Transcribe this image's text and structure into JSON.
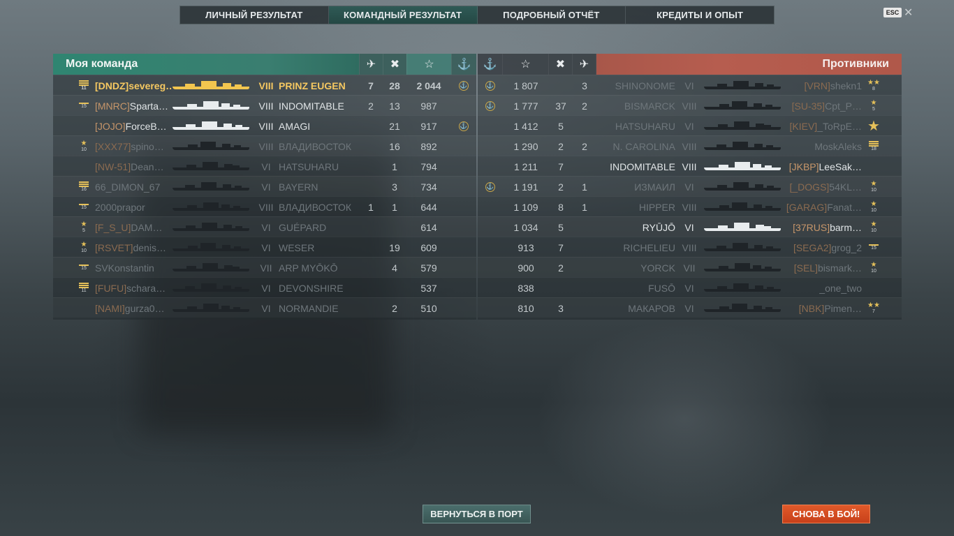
{
  "tabs": [
    {
      "label": "ЛИЧНЫЙ РЕЗУЛЬТАТ",
      "active": false
    },
    {
      "label": "КОМАНДНЫЙ РЕЗУЛЬТАТ",
      "active": true
    },
    {
      "label": "ПОДРОБНЫЙ ОТЧЁТ",
      "active": false
    },
    {
      "label": "КРЕДИТЫ И ОПЫТ",
      "active": false
    }
  ],
  "esc_label": "ESC",
  "my_team": {
    "title": "Моя команда",
    "header_icons": [
      "plane-kill-icon",
      "frag-icon",
      "star-icon",
      "anchor-icon"
    ],
    "rows": [
      {
        "rank": "11",
        "rank_style": "bars",
        "tag": "[DNDZ]",
        "player": "severeg…",
        "tier": "VIII",
        "ship": "PRINZ EUGEN",
        "c1": "7",
        "c2": "28",
        "xp": "2 044",
        "anchor": true,
        "style": "hl",
        "sil": "yellow"
      },
      {
        "rank": "15",
        "rank_style": "bar",
        "tag": "[MNRC]",
        "player": "Sparta…",
        "tier": "VIII",
        "ship": "INDOMITABLE",
        "c1": "2",
        "c2": "13",
        "xp": "987",
        "anchor": false,
        "style": "norm",
        "sil": "white"
      },
      {
        "rank": "",
        "rank_style": "none",
        "tag": "[JOJO]",
        "player": "ForceB…",
        "tier": "VIII",
        "ship": "AMAGI",
        "c1": "",
        "c2": "21",
        "xp": "917",
        "anchor": true,
        "style": "norm",
        "sil": "white"
      },
      {
        "rank": "10",
        "rank_style": "star",
        "tag": "[XXX77]",
        "player": "spino…",
        "tier": "VIII",
        "ship": "ВЛАДИВОСТОК",
        "c1": "",
        "c2": "16",
        "xp": "892",
        "anchor": false,
        "style": "dim",
        "sil": "dark"
      },
      {
        "rank": "",
        "rank_style": "none",
        "tag": "[NW-51]",
        "player": "Dean…",
        "tier": "VI",
        "ship": "HATSUHARU",
        "c1": "",
        "c2": "1",
        "xp": "794",
        "anchor": false,
        "style": "dim",
        "sil": "dark"
      },
      {
        "rank": "16",
        "rank_style": "bars",
        "tag": "",
        "player": "66_DIMON_67",
        "tier": "VI",
        "ship": "BAYERN",
        "c1": "",
        "c2": "3",
        "xp": "734",
        "anchor": false,
        "style": "dim",
        "sil": "dark"
      },
      {
        "rank": "15",
        "rank_style": "bar",
        "tag": "",
        "player": "2000prapor",
        "tier": "VIII",
        "ship": "ВЛАДИВОСТОК",
        "c1": "1",
        "c2": "1",
        "xp": "644",
        "anchor": false,
        "style": "dim",
        "sil": "dark"
      },
      {
        "rank": "5",
        "rank_style": "star",
        "tag": "[F_S_U]",
        "player": "DAM…",
        "tier": "VI",
        "ship": "GUÉPARD",
        "c1": "",
        "c2": "",
        "xp": "614",
        "anchor": false,
        "style": "dim",
        "sil": "dark"
      },
      {
        "rank": "10",
        "rank_style": "star",
        "tag": "[RSVET]",
        "player": "denis…",
        "tier": "VI",
        "ship": "WESER",
        "c1": "",
        "c2": "19",
        "xp": "609",
        "anchor": false,
        "style": "dim",
        "sil": "dark"
      },
      {
        "rank": "15",
        "rank_style": "bar",
        "tag": "",
        "player": "SVKonstantin",
        "tier": "VII",
        "ship": "ARP MYŌKŌ",
        "c1": "",
        "c2": "4",
        "xp": "579",
        "anchor": false,
        "style": "dim",
        "sil": "dark"
      },
      {
        "rank": "11",
        "rank_style": "bars",
        "tag": "[FUFU]",
        "player": "schara…",
        "tier": "VI",
        "ship": "DEVONSHIRE",
        "c1": "",
        "c2": "",
        "xp": "537",
        "anchor": false,
        "style": "dim",
        "sil": "dark"
      },
      {
        "rank": "",
        "rank_style": "none",
        "tag": "[NAMI]",
        "player": "gurza0…",
        "tier": "VI",
        "ship": "NORMANDIE",
        "c1": "",
        "c2": "2",
        "xp": "510",
        "anchor": false,
        "style": "dim",
        "sil": "dark"
      }
    ]
  },
  "enemies": {
    "title": "Противники",
    "header_icons": [
      "anchor-icon",
      "star-icon",
      "frag-icon",
      "plane-kill-icon"
    ],
    "rows": [
      {
        "anchor": true,
        "xp": "1 807",
        "c2": "",
        "c1": "3",
        "ship": "SHINONOME",
        "tier": "VI",
        "tag": "[VRN]",
        "player": "shekn1",
        "rank": "8",
        "rank_style": "stars",
        "style": "dim",
        "sil": "dark"
      },
      {
        "anchor": true,
        "xp": "1 777",
        "c2": "37",
        "c1": "2",
        "ship": "BISMARCK",
        "tier": "VIII",
        "tag": "[SU-35]",
        "player": "Cpt_P…",
        "rank": "5",
        "rank_style": "star",
        "style": "dim",
        "sil": "dark"
      },
      {
        "anchor": false,
        "xp": "1 412",
        "c2": "5",
        "c1": "",
        "ship": "HATSUHARU",
        "tier": "VI",
        "tag": "[KIEV]",
        "player": "_ToRpE…",
        "rank": "",
        "rank_style": "bigstar",
        "style": "dim",
        "sil": "dark"
      },
      {
        "anchor": false,
        "xp": "1 290",
        "c2": "2",
        "c1": "2",
        "ship": "N. CAROLINA",
        "tier": "VIII",
        "tag": "",
        "player": "MoskAleks",
        "rank": "18",
        "rank_style": "bars",
        "style": "dim",
        "sil": "dark"
      },
      {
        "anchor": false,
        "xp": "1 211",
        "c2": "7",
        "c1": "",
        "ship": "INDOMITABLE",
        "tier": "VIII",
        "tag": "[JKBP]",
        "player": "LeeSak…",
        "rank": "",
        "rank_style": "none",
        "style": "norm",
        "sil": "white"
      },
      {
        "anchor": true,
        "xp": "1 191",
        "c2": "2",
        "c1": "1",
        "ship": "ИЗМАИЛ",
        "tier": "VI",
        "tag": "[_DOGS]",
        "player": "54KL…",
        "rank": "10",
        "rank_style": "star",
        "style": "dim",
        "sil": "dark"
      },
      {
        "anchor": false,
        "xp": "1 109",
        "c2": "8",
        "c1": "1",
        "ship": "HIPPER",
        "tier": "VIII",
        "tag": "[GARAG]",
        "player": "Fanat…",
        "rank": "10",
        "rank_style": "star",
        "style": "dim",
        "sil": "dark"
      },
      {
        "anchor": false,
        "xp": "1 034",
        "c2": "5",
        "c1": "",
        "ship": "RYŪJŌ",
        "tier": "VI",
        "tag": "[37RUS]",
        "player": "barm…",
        "rank": "10",
        "rank_style": "star",
        "style": "norm",
        "sil": "white"
      },
      {
        "anchor": false,
        "xp": "913",
        "c2": "7",
        "c1": "",
        "ship": "RICHELIEU",
        "tier": "VIII",
        "tag": "[SEGA2]",
        "player": "grog_2",
        "rank": "15",
        "rank_style": "bar",
        "style": "dim",
        "sil": "dark"
      },
      {
        "anchor": false,
        "xp": "900",
        "c2": "2",
        "c1": "",
        "ship": "YORCK",
        "tier": "VII",
        "tag": "[SEL]",
        "player": "bismark…",
        "rank": "10",
        "rank_style": "star",
        "style": "dim",
        "sil": "dark"
      },
      {
        "anchor": false,
        "xp": "838",
        "c2": "",
        "c1": "",
        "ship": "FUSŌ",
        "tier": "VI",
        "tag": "",
        "player": "_one_two",
        "rank": "",
        "rank_style": "none",
        "style": "dim",
        "sil": "dark"
      },
      {
        "anchor": false,
        "xp": "810",
        "c2": "3",
        "c1": "",
        "ship": "МАКАРОВ",
        "tier": "VI",
        "tag": "[NBK]",
        "player": "Pimen…",
        "rank": "7",
        "rank_style": "stars",
        "style": "dim",
        "sil": "dark"
      }
    ]
  },
  "buttons": {
    "port": "ВЕРНУТЬСЯ В ПОРТ",
    "battle": "СНОВА В БОЙ!"
  },
  "colors": {
    "my_team_header": "#2f8571",
    "enemy_header": "#b65d4f",
    "highlight": "#f5c861",
    "clan_tag": "#c7966a",
    "battle_button": "#d84c22"
  }
}
